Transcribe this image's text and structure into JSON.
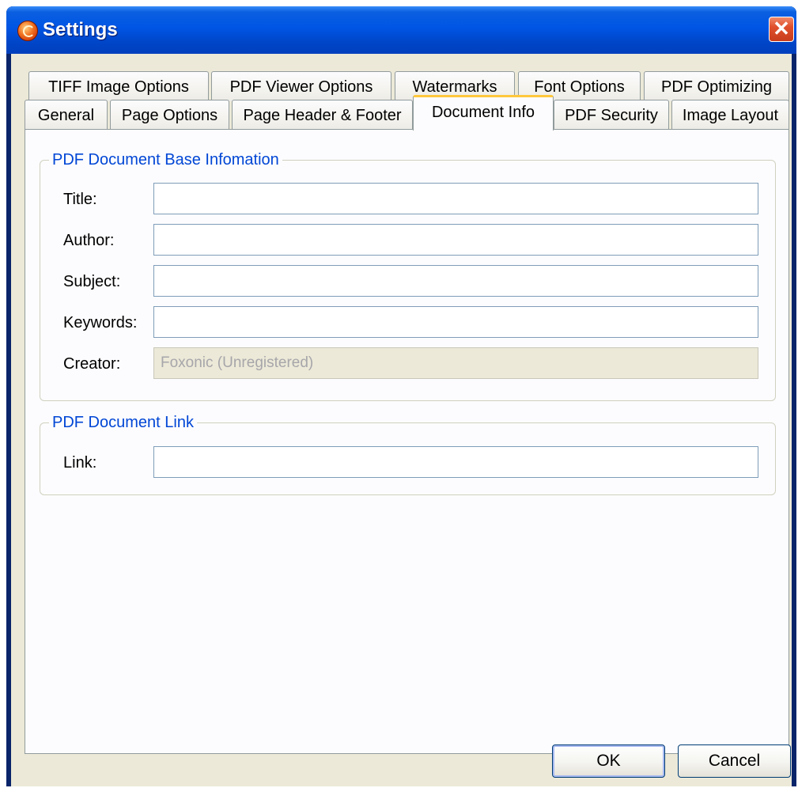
{
  "window": {
    "title": "Settings",
    "close_glyph": "✕",
    "icons": {
      "app": "foxonic-app-icon",
      "close": "close-icon"
    }
  },
  "tabs": {
    "row_back": [
      "TIFF Image Options",
      "PDF Viewer Options",
      "Watermarks",
      "Font Options",
      "PDF Optimizing"
    ],
    "row_front": [
      "General",
      "Page Options",
      "Page Header & Footer",
      "Document Info",
      "PDF Security",
      "Image Layout"
    ],
    "active": "Document Info"
  },
  "base_info": {
    "legend": "PDF Document Base Infomation",
    "fields": [
      {
        "label": "Title:",
        "value": ""
      },
      {
        "label": "Author:",
        "value": ""
      },
      {
        "label": "Subject:",
        "value": ""
      },
      {
        "label": "Keywords:",
        "value": ""
      },
      {
        "label": "Creator:",
        "value": "Foxonic (Unregistered)",
        "disabled": true
      }
    ]
  },
  "link_info": {
    "legend": "PDF Document Link",
    "field": {
      "label": "Link:",
      "value": ""
    }
  },
  "buttons": {
    "ok": "OK",
    "cancel": "Cancel"
  },
  "colors": {
    "titlebar": "#0055e5",
    "client_bg": "#ece9d8",
    "panel_bg": "#fcfcfe",
    "legend_text": "#0046d5",
    "active_tab_accent": "#ffc83c",
    "close_button": "#e0502c"
  }
}
